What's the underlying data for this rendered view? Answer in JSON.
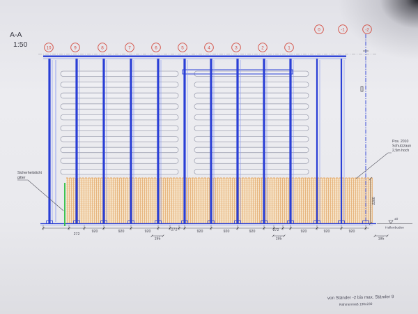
{
  "view": {
    "section": "A-A",
    "scale": "1:50"
  },
  "column_labels": {
    "main_row": [
      "10",
      "9",
      "8",
      "7",
      "6",
      "5",
      "4",
      "3",
      "2",
      "1"
    ],
    "upper_row": [
      "0",
      "-1",
      "-2"
    ]
  },
  "dimensions": {
    "bay_widths": [
      "272",
      "920",
      "920",
      "920",
      "272",
      "920",
      "920",
      "920",
      "272",
      "920",
      "920",
      "920"
    ],
    "end_offsets": [
      "195",
      "195",
      "195"
    ],
    "fence_height": "2200"
  },
  "annotations": {
    "light_grid": {
      "line1": "Sicherheitslicht",
      "line2": "gitter"
    },
    "fence": {
      "line1": "Pos. 2010",
      "line2": "Schutzzaun",
      "line3": "2,5m hoch"
    },
    "floor_level": "±0",
    "floor_label": "Hallenboden",
    "range_note": "von Ständer -2 bis max. Ständer 9",
    "frame_note": "Rahmenmaß 190x230"
  },
  "colors": {
    "upright": "#2a3fd6",
    "upright_edge": "#8d9cf2",
    "axis_label": "#d4483c",
    "shelf": "#a1a4b3",
    "shelf_fill": "#efeff3",
    "fence_mesh": "#e2a565",
    "fence_mesh_fill": "#f5e2c6",
    "light_grid": "#2dbf3e",
    "annotation_text": "#3d3d48"
  }
}
